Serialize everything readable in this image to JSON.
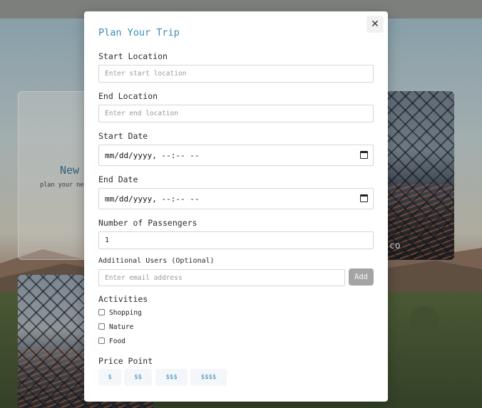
{
  "background": {
    "new_card_title": "New",
    "new_card_subtitle": "plan your ne",
    "right_card_text": "co"
  },
  "modal": {
    "title": "Plan Your Trip",
    "close_icon": "close-icon",
    "start_location": {
      "label": "Start Location",
      "placeholder": "Enter start location"
    },
    "end_location": {
      "label": "End Location",
      "placeholder": "Enter end location"
    },
    "start_date": {
      "label": "Start Date",
      "value": "mm/dd/yyyy, --:-- --"
    },
    "end_date": {
      "label": "End Date",
      "value": "mm/dd/yyyy, --:-- --"
    },
    "passengers": {
      "label": "Number of Passengers",
      "value": "1"
    },
    "additional_users": {
      "label": "Additional Users (Optional)",
      "placeholder": "Enter email address",
      "add_label": "Add"
    },
    "activities": {
      "label": "Activities",
      "options": [
        "Shopping",
        "Nature",
        "Food"
      ]
    },
    "price_point": {
      "label": "Price Point",
      "options": [
        "$",
        "$$",
        "$$$",
        "$$$$"
      ]
    }
  }
}
